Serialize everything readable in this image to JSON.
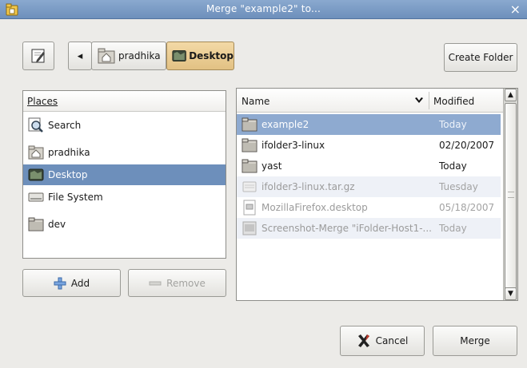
{
  "window": {
    "title": "Merge \"example2\" to...",
    "close_glyph": "×"
  },
  "toolbar": {
    "edit_icon": "pencil-document-icon",
    "back_glyph": "◂",
    "path": [
      {
        "label": "pradhika",
        "icon": "home-folder-icon",
        "active": false
      },
      {
        "label": "Desktop",
        "icon": "desktop-icon",
        "active": true
      }
    ],
    "create_folder_label": "Create Folder"
  },
  "places": {
    "header": "Places",
    "header_mnemonic": "P",
    "items": [
      {
        "label": "Search",
        "icon": "search-icon",
        "selected": false
      },
      {
        "label": "pradhika",
        "icon": "home-folder-icon",
        "selected": false
      },
      {
        "label": "Desktop",
        "icon": "desktop-icon",
        "selected": true
      },
      {
        "label": "File System",
        "icon": "drive-icon",
        "selected": false
      },
      {
        "label": "dev",
        "icon": "folder-icon",
        "selected": false
      }
    ],
    "add_label": "Add",
    "remove_label": "Remove"
  },
  "files": {
    "col_name": "Name",
    "col_modified": "Modified",
    "sort_glyph": "⌄",
    "rows": [
      {
        "name": "example2",
        "modified": "Today",
        "icon": "folder-icon",
        "state": "sel"
      },
      {
        "name": "ifolder3-linux",
        "modified": "02/20/2007",
        "icon": "folder-icon",
        "state": ""
      },
      {
        "name": "yast",
        "modified": "Today",
        "icon": "folder-icon",
        "state": ""
      },
      {
        "name": "ifolder3-linux.tar.gz",
        "modified": "Tuesday",
        "icon": "archive-icon",
        "state": "dim alt"
      },
      {
        "name": "MozillaFirefox.desktop",
        "modified": "05/18/2007",
        "icon": "desktop-file-icon",
        "state": "dim"
      },
      {
        "name": "Screenshot-Merge \"iFolder-Host1-...",
        "modified": "Today",
        "icon": "image-file-icon",
        "state": "dim alt"
      }
    ]
  },
  "actions": {
    "cancel_label": "Cancel",
    "merge_label": "Merge"
  },
  "colors": {
    "selection": "#6d8fbb",
    "title_bar": "#7c9cc6"
  }
}
